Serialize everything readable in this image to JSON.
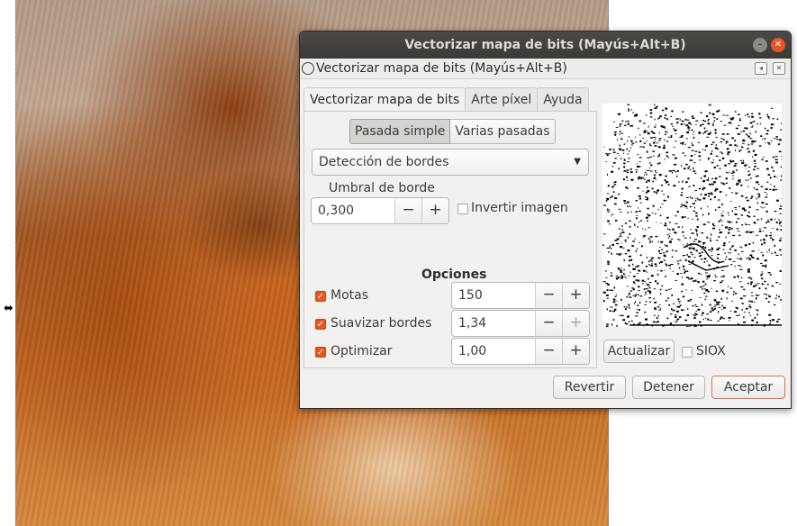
{
  "window": {
    "title": "Vectorizar mapa de bits (Mayús+Alt+B)",
    "dock_title": "Vectorizar mapa de bits (Mayús+Alt+B)"
  },
  "tabs": [
    {
      "label": "Vectorizar mapa de bits",
      "active": true
    },
    {
      "label": "Arte píxel",
      "active": false
    },
    {
      "label": "Ayuda",
      "active": false
    }
  ],
  "mode": {
    "single": "Pasada simple",
    "multi": "Varias pasadas",
    "selected": "Pasada simple"
  },
  "method": {
    "selected": "Detección de bordes"
  },
  "edge": {
    "label": "Umbral de borde",
    "value": "0,300",
    "invert_label": "Invertir imagen",
    "invert_checked": false
  },
  "options": {
    "title": "Opciones",
    "items": [
      {
        "label": "Motas",
        "checked": true,
        "value": "150"
      },
      {
        "label": "Suavizar bordes",
        "checked": true,
        "value": "1,34"
      },
      {
        "label": "Optimizar",
        "checked": true,
        "value": "1,00"
      }
    ]
  },
  "preview": {
    "update_label": "Actualizar",
    "siox_label": "SIOX",
    "siox_checked": false
  },
  "actions": {
    "revert": "Revertir",
    "stop": "Detener",
    "ok": "Aceptar"
  },
  "icons": {
    "minimize": "minimize-icon",
    "close": "close-icon",
    "dock": "dock-icon",
    "combo_arrow": "chevron-down-icon",
    "resize": "resize-horizontal-icon"
  },
  "colors": {
    "accent": "#e95420",
    "titlebar": "#3d3c38",
    "window_bg": "#f2f1f0"
  }
}
